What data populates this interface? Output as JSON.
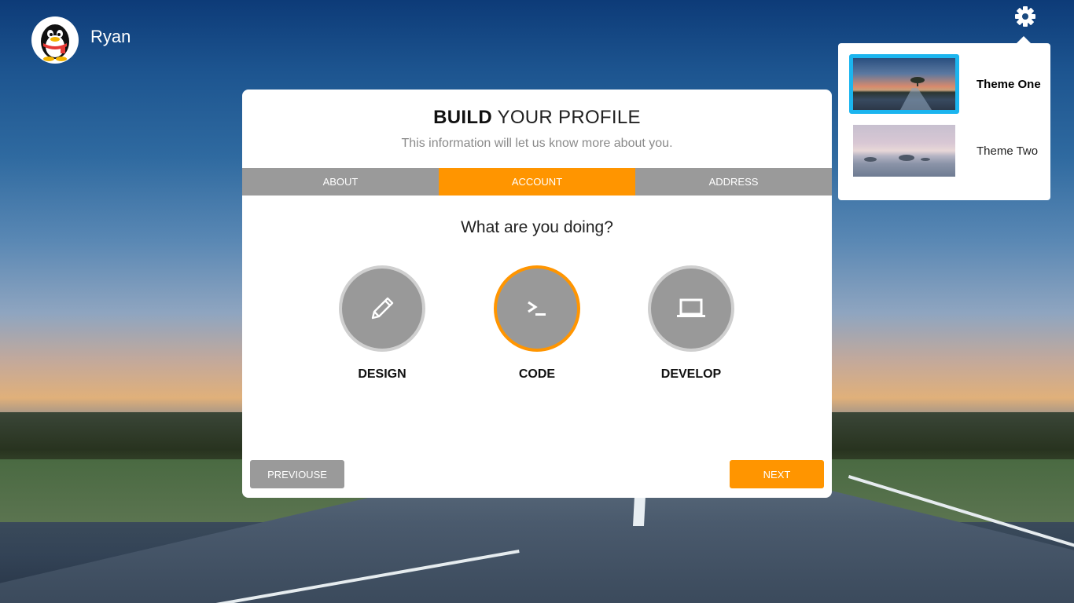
{
  "user": {
    "name": "Ryan",
    "avatar_icon": "penguin-icon"
  },
  "settings": {
    "icon": "gear-icon"
  },
  "themes": {
    "items": [
      {
        "label": "Theme One",
        "selected": true
      },
      {
        "label": "Theme Two",
        "selected": false
      }
    ],
    "selected_color": "#1bb5ef"
  },
  "card": {
    "title_bold": "BUILD",
    "title_rest": " YOUR PROFILE",
    "subtitle": "This information will let us know more about you.",
    "tabs": [
      {
        "label": "ABOUT",
        "active": false
      },
      {
        "label": "ACCOUNT",
        "active": true
      },
      {
        "label": "ADDRESS",
        "active": false
      }
    ],
    "question": "What are you doing?",
    "choices": [
      {
        "label": "DESIGN",
        "icon": "pencil-icon",
        "active": false
      },
      {
        "label": "CODE",
        "icon": "terminal-icon",
        "active": true
      },
      {
        "label": "DEVELOP",
        "icon": "laptop-icon",
        "active": false
      }
    ],
    "prev_label": "PREVIOUSE",
    "next_label": "NEXT"
  },
  "colors": {
    "accent": "#ff9500",
    "neutral": "#9a9a9a"
  }
}
